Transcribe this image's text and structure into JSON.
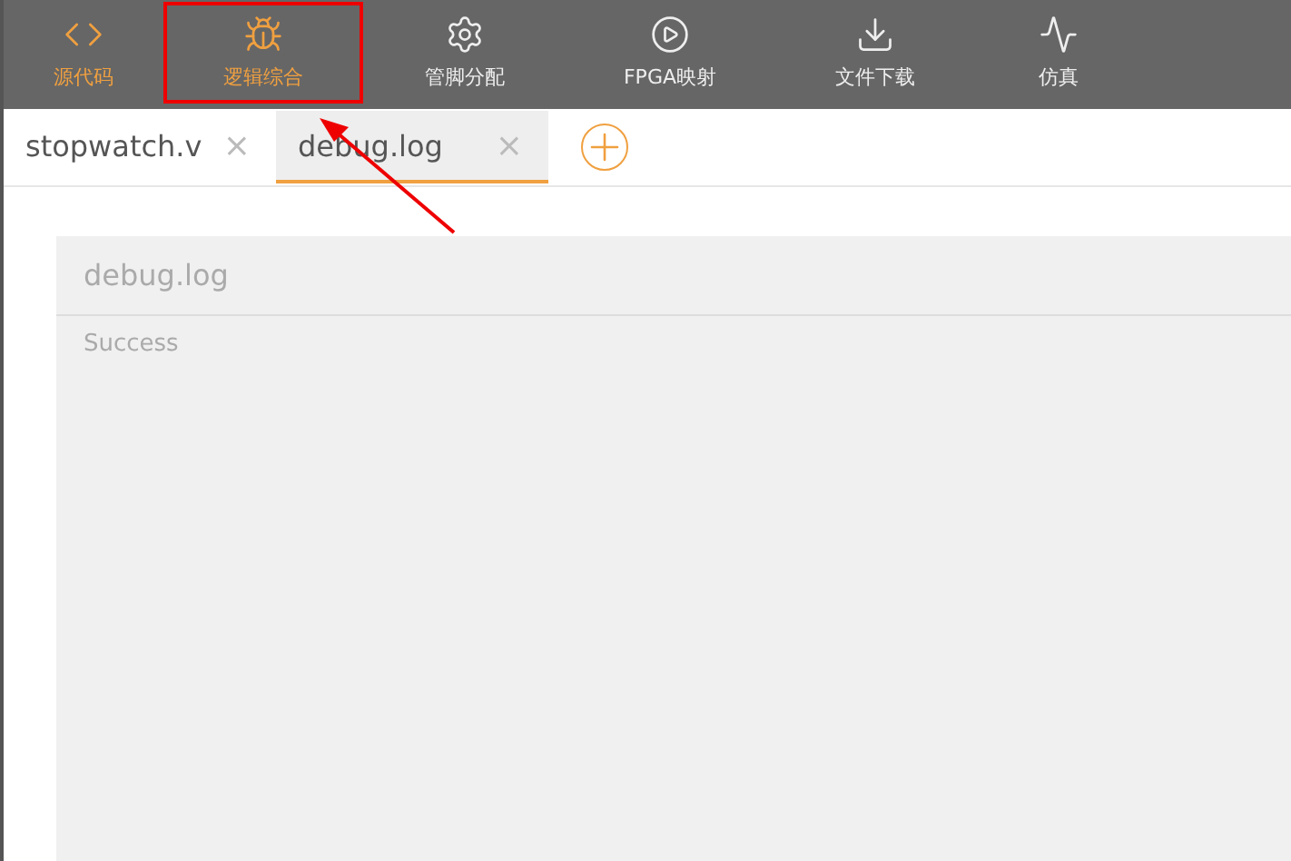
{
  "toolbar": {
    "items": [
      {
        "kind": "code",
        "label": "源代码",
        "active": true,
        "highlighted": false
      },
      {
        "kind": "bug",
        "label": "逻辑综合",
        "active": true,
        "highlighted": true
      },
      {
        "kind": "gear",
        "label": "管脚分配",
        "active": false,
        "highlighted": false
      },
      {
        "kind": "play",
        "label": "FPGA映射",
        "active": false,
        "highlighted": false
      },
      {
        "kind": "download",
        "label": "文件下载",
        "active": false,
        "highlighted": false
      },
      {
        "kind": "wave",
        "label": "仿真",
        "active": false,
        "highlighted": false
      }
    ]
  },
  "tabs": [
    {
      "label": "stopwatch.v",
      "close": "×",
      "selected": false
    },
    {
      "label": "debug.log",
      "close": "×",
      "selected": true
    }
  ],
  "log_panel": {
    "title": "debug.log",
    "text": "Success"
  }
}
